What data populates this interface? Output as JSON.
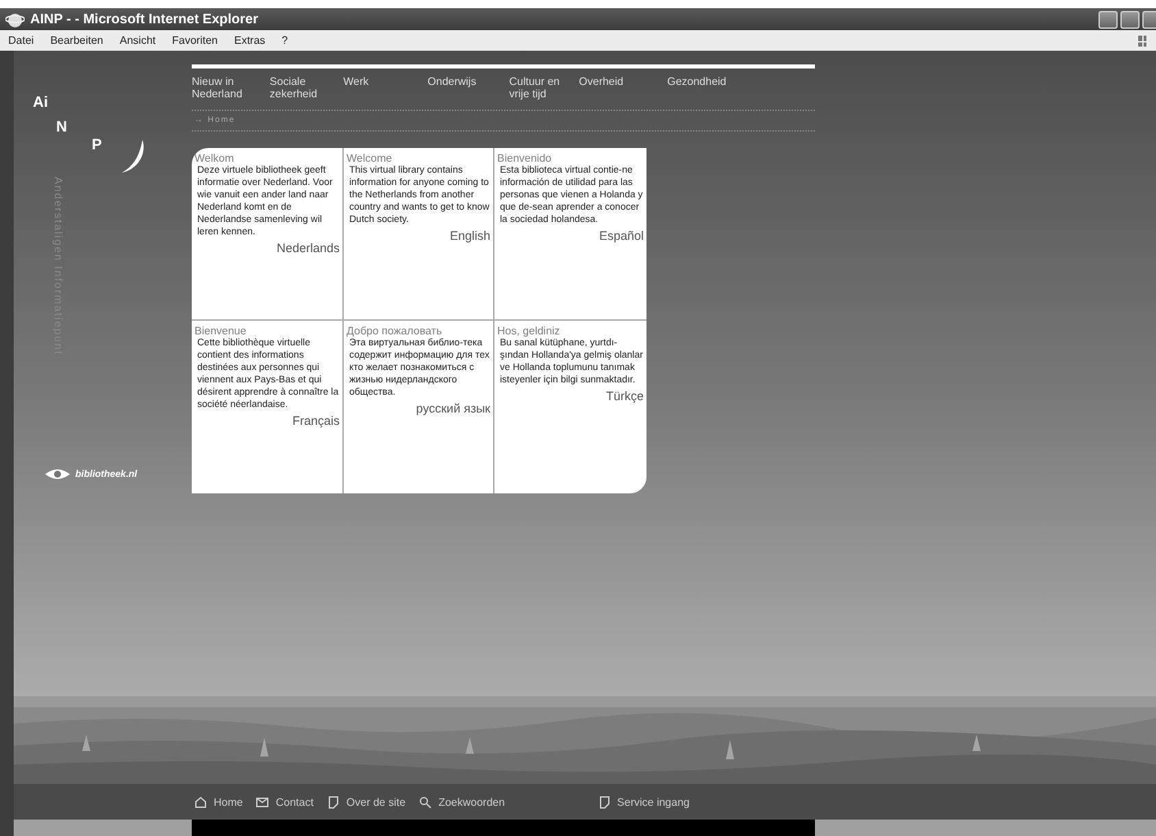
{
  "window": {
    "title": "AINP - - Microsoft Internet Explorer"
  },
  "menu": [
    "Datei",
    "Bearbeiten",
    "Ansicht",
    "Favoriten",
    "Extras",
    "?"
  ],
  "logo": {
    "letters": [
      "Ai",
      "N",
      "P"
    ]
  },
  "side_caption": "Anderstaligen Informatiepunt",
  "partner": "bibliotheek.nl",
  "nav": [
    "Nieuw in\nNederland",
    "Sociale\nzekerheid",
    "Werk",
    "Onderwijs",
    "Cultuur en\nvrije tijd",
    "Overheid",
    "Gezondheid"
  ],
  "breadcrumb": "→ Home",
  "cards": [
    {
      "heading": "Welkom",
      "body": "Deze virtuele bibliotheek geeft informatie over Nederland. Voor wie vanuit een ander land naar Nederland komt en de Nederlandse samenleving wil leren kennen.",
      "language": "Nederlands"
    },
    {
      "heading": "Welcome",
      "body": "This virtual library contains information for anyone coming to the Netherlands from another country and wants to get to know Dutch society.",
      "language": "English"
    },
    {
      "heading": "Bienvenido",
      "body": "Esta biblioteca virtual contie-ne información de utilidad para las personas que vienen a Holanda y que de-sean aprender a conocer la sociedad holandesa.",
      "language": "Español"
    },
    {
      "heading": "Bienvenue",
      "body": "Cette bibliothèque virtuelle contient des informations destinées aux personnes qui viennent aux Pays-Bas et qui désirent apprendre à connaître la société néerlandaise.",
      "language": "Français"
    },
    {
      "heading": "Добро пожаловать",
      "body": "Эта виртуальная библио-тека содержит информацию для тех кто желает познакомиться с жизнью нидерландского общества.",
      "language": "русский язык"
    },
    {
      "heading": "Hos, geldiniz",
      "body": "Bu sanal kütüphane, yurtdı-şından Hollanda'ya gelmiş olanlar ve Hollanda toplumunu tanımak isteyenler için bilgi sunmaktadır.",
      "language": "Türkçe"
    }
  ],
  "footer": [
    {
      "label": "Home",
      "kind": "home"
    },
    {
      "label": "Contact",
      "kind": "mail"
    },
    {
      "label": "Over de site",
      "kind": "page"
    },
    {
      "label": "Zoekwoorden",
      "kind": "search"
    },
    {
      "label": "Service ingang",
      "kind": "page"
    }
  ]
}
